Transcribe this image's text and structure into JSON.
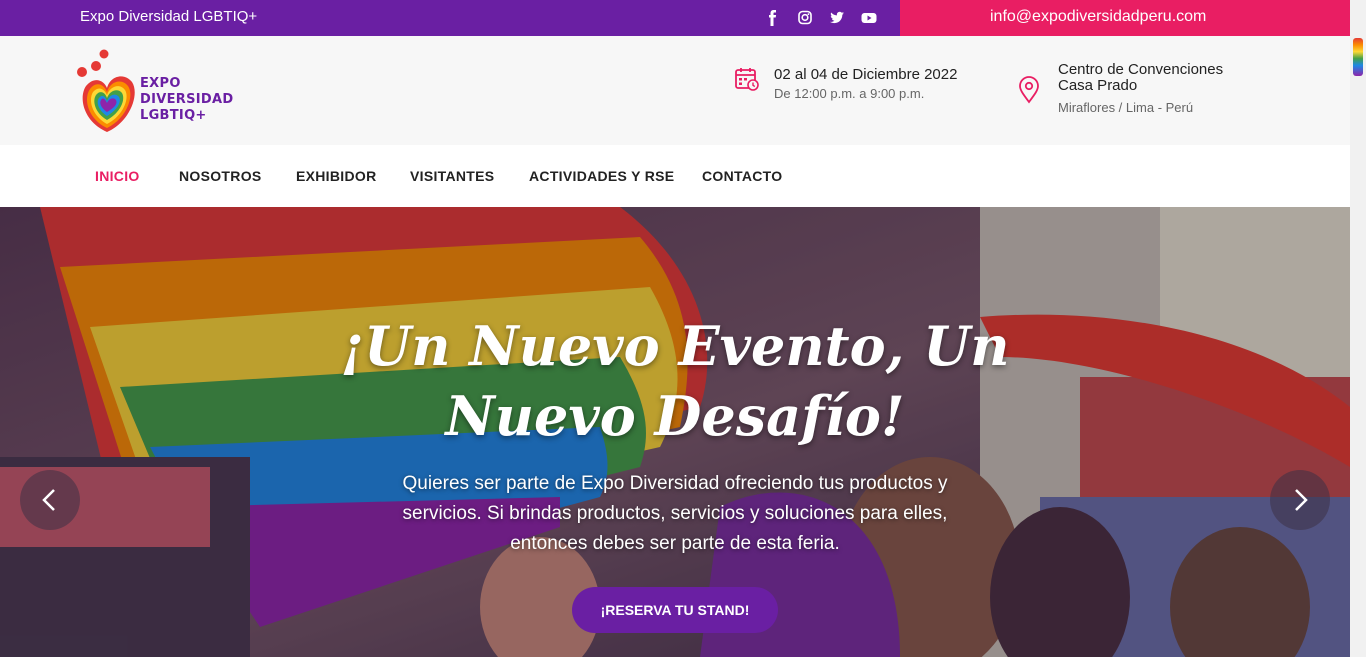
{
  "topbar": {
    "brand": "Expo Diversidad LGBTIQ+",
    "email": "info@expodiversidadperu.com",
    "socials": [
      "facebook-icon",
      "instagram-icon",
      "twitter-icon",
      "youtube-icon"
    ],
    "left_color": "#6a1fa3",
    "right_color": "#e91e63"
  },
  "logo": {
    "lines": [
      "EXPO",
      "DIVERSIDAD",
      "LGBTIQ+"
    ]
  },
  "event": {
    "date": "02 al 04 de Diciembre 2022",
    "hours": "De 12:00 p.m. a 9:00 p.m.",
    "venue": "Centro de Convenciones Casa Prado",
    "city": "Miraflores / Lima - Perú",
    "icon_color": "#e91e63"
  },
  "nav": {
    "items": [
      {
        "label": "INICIO",
        "active": true
      },
      {
        "label": "NOSOTROS"
      },
      {
        "label": "EXHIBIDOR"
      },
      {
        "label": "VISITANTES"
      },
      {
        "label": "ACTIVIDADES Y RSE"
      },
      {
        "label": "CONTACTO"
      }
    ],
    "active_color": "#e91e63"
  },
  "hero": {
    "title": "¡Un Nuevo Evento, Un Nuevo Desafío!",
    "description": "Quieres ser parte de Expo Diversidad ofreciendo tus productos y servicios. Si brindas productos, servicios y soluciones para elles, entonces debes ser parte de esta feria.",
    "cta": "¡RESERVA TU STAND!",
    "cta_color": "#6a1fa3"
  }
}
